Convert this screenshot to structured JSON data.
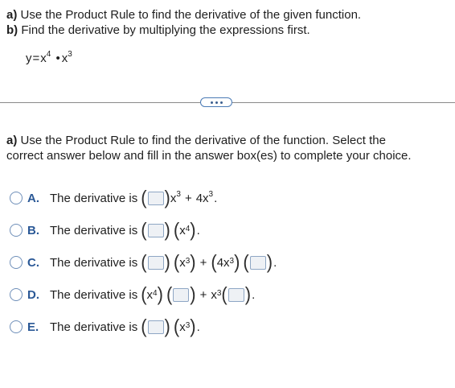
{
  "question": {
    "part_a_label": "a)",
    "part_a_text": "Use the Product Rule to find the derivative of the given function.",
    "part_b_label": "b)",
    "part_b_text": "Find the derivative by multiplying the expressions first.",
    "function": {
      "y": "y",
      "eq": "=",
      "base1": "x",
      "exp1": "4",
      "dot": "•",
      "base2": "x",
      "exp2": "3"
    }
  },
  "more_button": {
    "icon": "ellipsis-icon"
  },
  "instruction": {
    "label": "a)",
    "line1": "Use the Product Rule to find the derivative of the function. Select the",
    "line2": "correct answer below and fill in the answer box(es) to complete your choice."
  },
  "options": [
    {
      "letter": "A.",
      "lead": "The derivative is"
    },
    {
      "letter": "B.",
      "lead": "The derivative is"
    },
    {
      "letter": "C.",
      "lead": "The derivative is"
    },
    {
      "letter": "D.",
      "lead": "The derivative is"
    },
    {
      "letter": "E.",
      "lead": "The derivative is"
    }
  ],
  "expressions": {
    "a": {
      "t1_base": "x",
      "t1_exp": "3",
      "plus": "+",
      "t2_base": "4x",
      "t2_exp": "3",
      "end": "."
    },
    "b": {
      "base": "x",
      "exp": "4",
      "end": "."
    },
    "c": {
      "b1": "x",
      "e1": "3",
      "plus": "+",
      "b2": "4x",
      "e2": "3",
      "end": "."
    },
    "d": {
      "b1": "x",
      "e1": "4",
      "plus": "+",
      "b2": "x",
      "e2": "3",
      "end": "."
    },
    "e": {
      "base": "x",
      "exp": "3",
      "end": "."
    }
  },
  "colors": {
    "accent": "#2a5896",
    "radio_border": "#6f8fb9",
    "answer_box_bg": "#eef1f5"
  }
}
